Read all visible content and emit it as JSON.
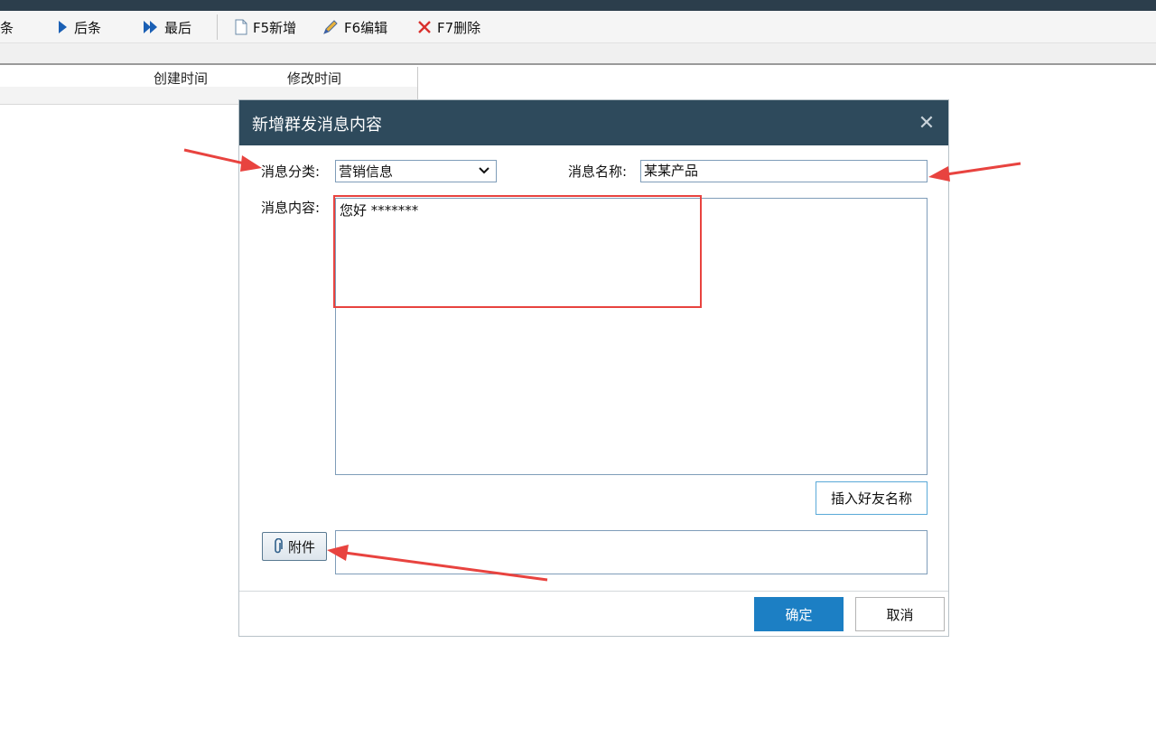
{
  "toolbar": {
    "prev_label": "条",
    "next_label": "后条",
    "last_label": "最后",
    "new_label": "F5新增",
    "edit_label": "F6编辑",
    "delete_label": "F7删除"
  },
  "grid": {
    "columns": [
      "创建时间",
      "修改时间"
    ]
  },
  "dialog": {
    "title": "新增群发消息内容",
    "category_label": "消息分类:",
    "category_value": "营销信息",
    "name_label": "消息名称:",
    "name_value": "某某产品",
    "content_label": "消息内容:",
    "content_value": "您好 *******",
    "insert_friend_label": "插入好友名称",
    "attach_label": "附件",
    "ok_label": "确定",
    "cancel_label": "取消"
  },
  "colors": {
    "titlebar": "#2e4a5c",
    "primary_button": "#1c7fc4",
    "annotation": "#e8433f"
  },
  "icons": [
    "arrow-right-icon",
    "double-arrow-right-icon",
    "new-document-icon",
    "edit-pen-icon",
    "delete-x-icon",
    "chevron-down-icon",
    "paperclip-icon",
    "close-icon"
  ]
}
